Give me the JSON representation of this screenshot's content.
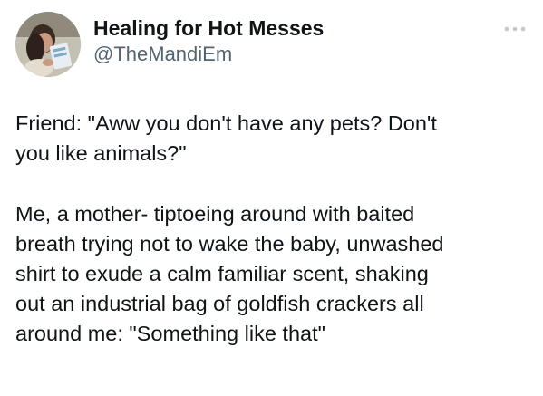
{
  "author": {
    "display_name": "Healing for Hot Messes",
    "handle": "@TheMandiEm",
    "avatar_icon": "profile-photo"
  },
  "more_icon": "ellipsis-icon",
  "tweet": {
    "text": "Friend: \"Aww you don't have any pets? Don't\nyou like animals?\"\n\nMe, a mother- tiptoeing around with baited\nbreath trying not to wake the baby, unwashed\nshirt to exude a calm familiar scent, shaking\nout an industrial bag of goldfish crackers all\naround me: \"Something like that\""
  },
  "colors": {
    "text": "#0f1419",
    "secondary": "#536471",
    "background": "#ffffff"
  }
}
